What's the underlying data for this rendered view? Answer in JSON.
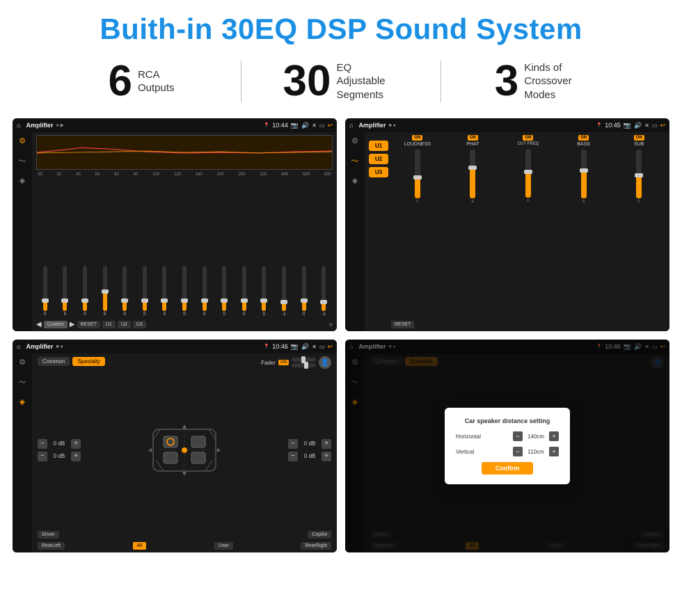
{
  "header": {
    "title": "Buith-in 30EQ DSP Sound System"
  },
  "stats": [
    {
      "number": "6",
      "text_line1": "RCA",
      "text_line2": "Outputs"
    },
    {
      "number": "30",
      "text_line1": "EQ Adjustable",
      "text_line2": "Segments"
    },
    {
      "number": "3",
      "text_line1": "Kinds of",
      "text_line2": "Crossover Modes"
    }
  ],
  "screen1": {
    "status": {
      "app": "Amplifier",
      "time": "10:44"
    },
    "eq_freqs": [
      "25",
      "32",
      "40",
      "50",
      "63",
      "80",
      "100",
      "125",
      "160",
      "200",
      "250",
      "320",
      "400",
      "500",
      "630"
    ],
    "eq_values": [
      "0",
      "0",
      "0",
      "5",
      "0",
      "0",
      "0",
      "0",
      "0",
      "0",
      "0",
      "0",
      "-1",
      "0",
      "-1"
    ],
    "preset_label": "Custom",
    "buttons": [
      "RESET",
      "U1",
      "U2",
      "U3"
    ]
  },
  "screen2": {
    "status": {
      "app": "Amplifier",
      "time": "10:45"
    },
    "presets": [
      "U1",
      "U2",
      "U3"
    ],
    "channels": [
      {
        "on": true,
        "label": "LOUDNESS"
      },
      {
        "on": true,
        "label": "PHAT"
      },
      {
        "on": true,
        "label": "CUT FREQ"
      },
      {
        "on": true,
        "label": "BASS"
      },
      {
        "on": true,
        "label": "SUB"
      }
    ],
    "reset_label": "RESET"
  },
  "screen3": {
    "status": {
      "app": "Amplifier",
      "time": "10:46"
    },
    "tabs": [
      "Common",
      "Specialty"
    ],
    "fader_label": "Fader",
    "on_badge": "ON",
    "zones": {
      "left_top": "0 dB",
      "left_bottom": "0 dB",
      "right_top": "0 dB",
      "right_bottom": "0 dB"
    },
    "bottom_buttons": [
      "Driver",
      "",
      "Copilot",
      "RearLeft",
      "All",
      "User",
      "RearRight"
    ]
  },
  "screen4": {
    "status": {
      "app": "Amplifier",
      "time": "10:46"
    },
    "tabs": [
      "Common",
      "Specialty"
    ],
    "dialog": {
      "title": "Car speaker distance setting",
      "horizontal_label": "Horizontal",
      "horizontal_value": "140cm",
      "vertical_label": "Vertical",
      "vertical_value": "110cm",
      "confirm_label": "Confirm"
    },
    "zones": {
      "left_top": "0 dB",
      "left_bottom": "0 dB"
    },
    "bottom_buttons": [
      "Driver",
      "Copilot",
      "RearLeft",
      "User",
      "RearRight"
    ]
  }
}
